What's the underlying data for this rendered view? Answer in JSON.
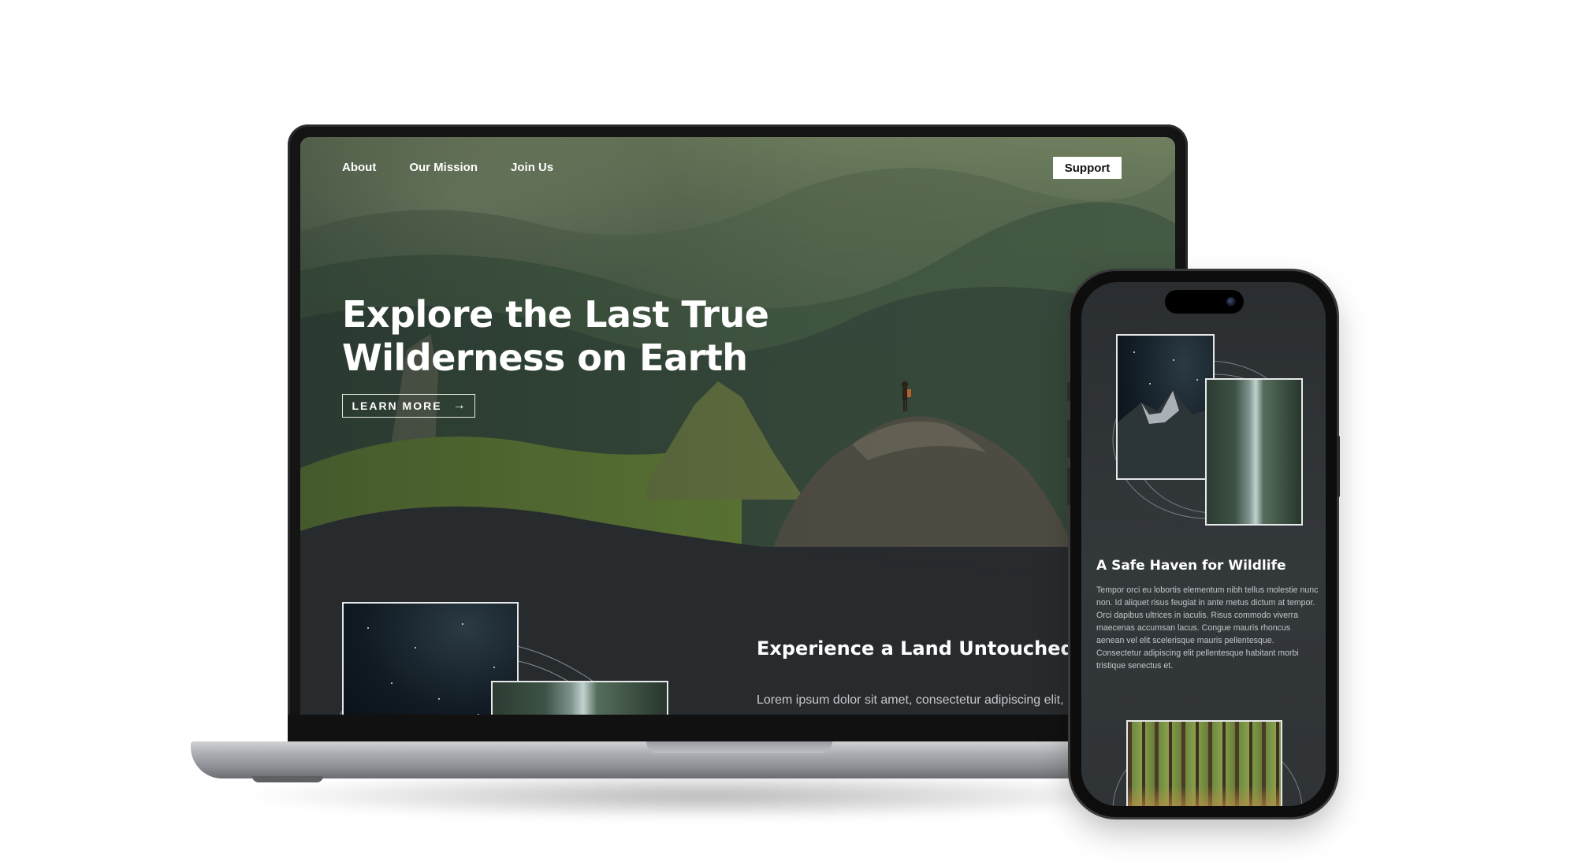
{
  "desktop": {
    "nav": {
      "items": [
        "About",
        "Our Mission",
        "Join Us"
      ],
      "support_label": "Support"
    },
    "hero": {
      "title": "Explore the Last True Wilderness on Earth",
      "cta_label": "LEARN MORE",
      "cta_icon": "arrow-right-icon"
    },
    "section": {
      "title": "Experience a Land Untouched by Human Influence",
      "text": "Lorem ipsum dolor sit amet, consectetur adipiscing elit,"
    }
  },
  "mobile": {
    "section": {
      "title": "A Safe Haven for Wildlife",
      "text": "Tempor orci eu lobortis elementum nibh tellus molestie nunc non. Id aliquet risus feugiat in ante metus dictum at tempor. Orci dapibus ultrices in iaculis. Risus commodo viverra maecenas accumsan lacus. Congue mauris rhoncus aenean vel elit scelerisque mauris pellentesque. Consectetur adipiscing elit pellentesque habitant morbi tristique senectus et."
    }
  },
  "colors": {
    "dark_background": "#272b2e",
    "text_white": "#ffffff",
    "muted_text": "#c6c9cb"
  }
}
